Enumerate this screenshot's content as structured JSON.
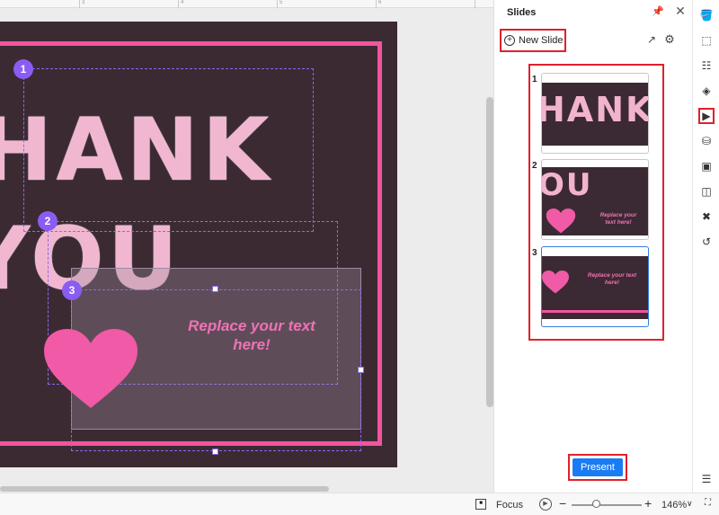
{
  "panel": {
    "title": "Slides",
    "new_slide_label": "New Slide",
    "present_label": "Present",
    "thumbnails": [
      {
        "number": "1",
        "text": "HANK"
      },
      {
        "number": "2",
        "text": "OU",
        "caption": "Replace your text here!"
      },
      {
        "number": "3",
        "caption": "Replace your text here!"
      }
    ]
  },
  "canvas": {
    "heading_line1": "HANK",
    "heading_line2": "YOU",
    "badges": [
      "1",
      "2",
      "3"
    ],
    "body_text": "Replace your text here!"
  },
  "ruler": {
    "marks": [
      "3",
      "4",
      "5",
      "6"
    ]
  },
  "toolbar": {
    "icons": [
      "paint-bucket-icon",
      "style-icon",
      "grid-icon",
      "layers-icon",
      "slideshow-icon",
      "database-icon",
      "image-icon",
      "symbol-icon",
      "shuffle-icon",
      "history-icon",
      "settings-list-icon"
    ]
  },
  "status": {
    "focus_label": "Focus",
    "zoom": "146%"
  },
  "colors": {
    "accent": "#1a7cf2",
    "highlight": "#e0202b",
    "slide_bg": "#3c2a33",
    "pink": "#f2559f",
    "selection": "#8d67f0"
  }
}
